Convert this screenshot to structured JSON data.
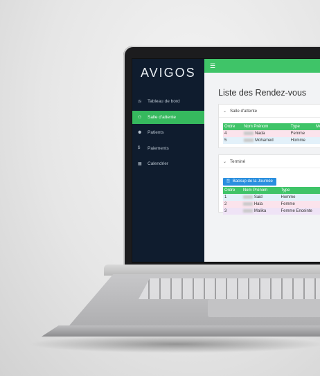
{
  "app": {
    "logo_text": "AVIGOS"
  },
  "sidebar": {
    "items": [
      {
        "label": "Tableau de bord",
        "icon": "clock-icon",
        "active": false
      },
      {
        "label": "Salle d'attente",
        "icon": "user-icon",
        "active": true
      },
      {
        "label": "Patients",
        "icon": "users-icon",
        "active": false
      },
      {
        "label": "Paiements",
        "icon": "dollar-icon",
        "active": false
      },
      {
        "label": "Calendrier",
        "icon": "calendar-icon",
        "active": false
      }
    ]
  },
  "topbar": {
    "menu_icon": "hamburger-icon",
    "accent": "#3fc468"
  },
  "main": {
    "title": "Liste des Rendez-vous",
    "waiting": {
      "header": "Salle d'attente",
      "columns": [
        "Ordre",
        "Nom Prénom",
        "Type",
        "Mo"
      ],
      "rows": [
        {
          "ordre": "4",
          "nom": "Nada",
          "type": "Femme"
        },
        {
          "ordre": "5",
          "nom": "Mohamed",
          "type": "Homme"
        }
      ]
    },
    "done": {
      "header": "Terminé",
      "backup_label": "Backup de la Journée",
      "columns": [
        "Ordre",
        "Nom Prénom",
        "Type"
      ],
      "rows": [
        {
          "ordre": "1",
          "nom": "Said",
          "type": "Homme"
        },
        {
          "ordre": "2",
          "nom": "Hala",
          "type": "Femme"
        },
        {
          "ordre": "3",
          "nom": "Malika",
          "type": "Femme Enceinte"
        }
      ]
    }
  },
  "colors": {
    "sidebar": "#0f1c2e",
    "active": "#36b95e",
    "button": "#2a8fdf"
  }
}
